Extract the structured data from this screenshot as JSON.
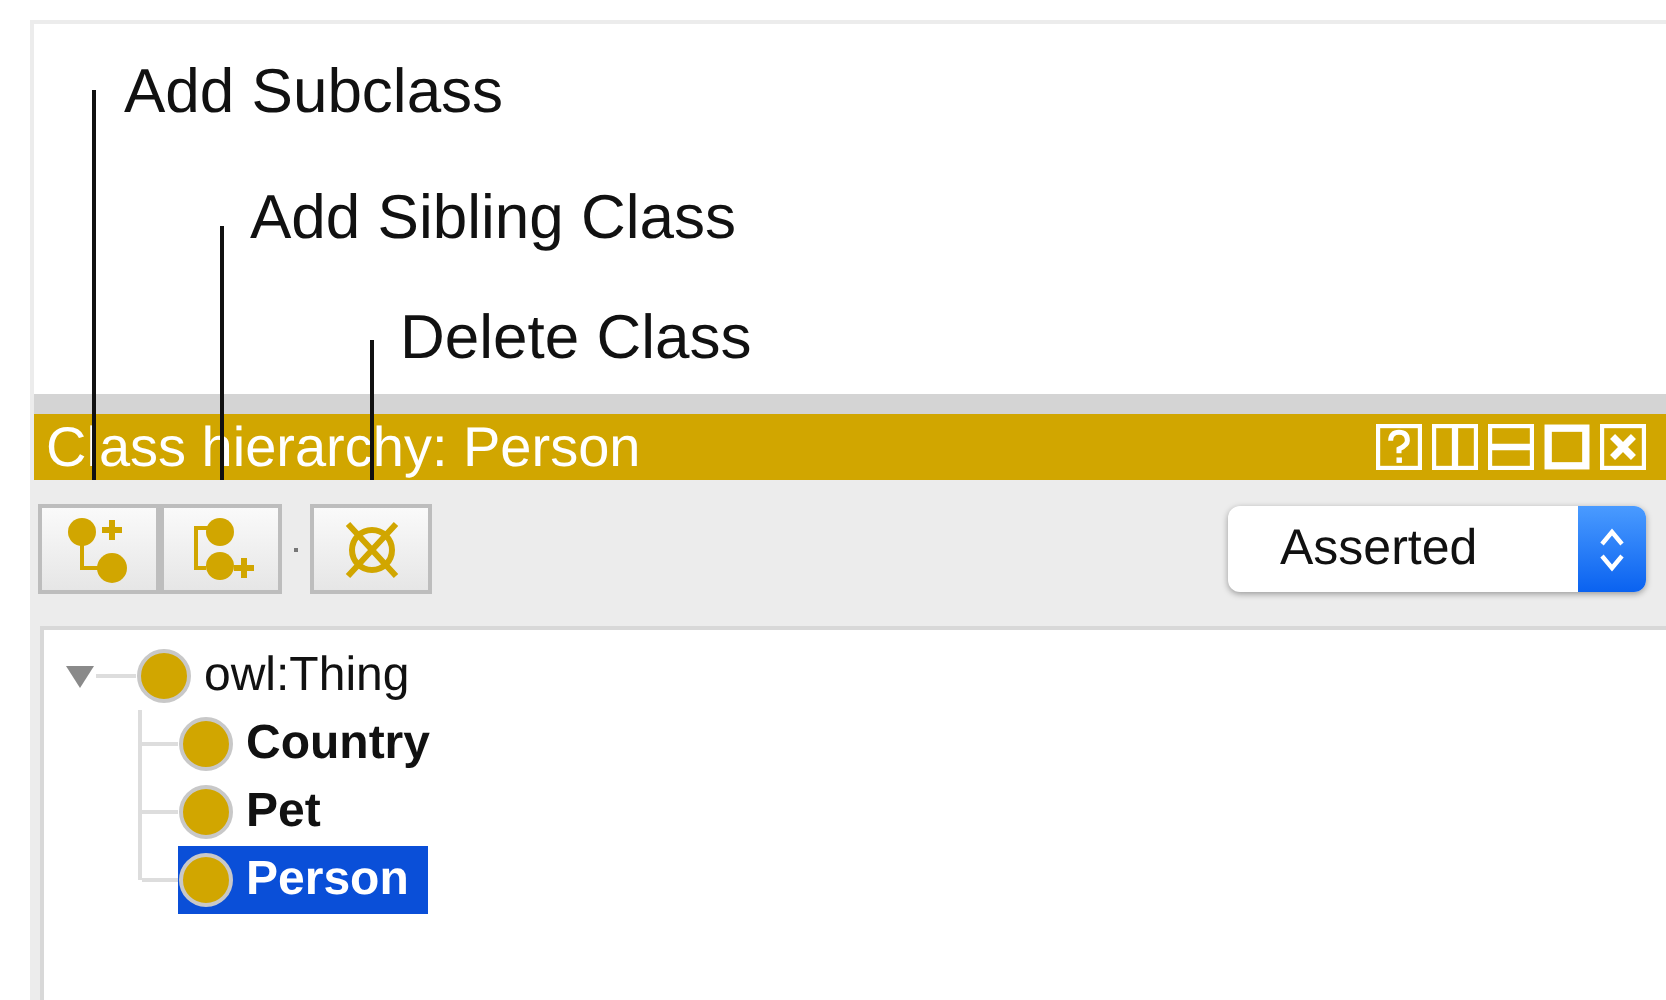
{
  "callouts": [
    {
      "label": "Add Subclass"
    },
    {
      "label": "Add Sibling Class"
    },
    {
      "label": "Delete Class"
    }
  ],
  "panel": {
    "title": "Class hierarchy: Person"
  },
  "view_selector": {
    "value": "Asserted"
  },
  "tree": [
    {
      "label": "owl:Thing",
      "expanded": true,
      "selected": false,
      "children": [
        {
          "label": "Country",
          "selected": false
        },
        {
          "label": "Pet",
          "selected": false
        },
        {
          "label": "Person",
          "selected": true
        }
      ]
    }
  ]
}
